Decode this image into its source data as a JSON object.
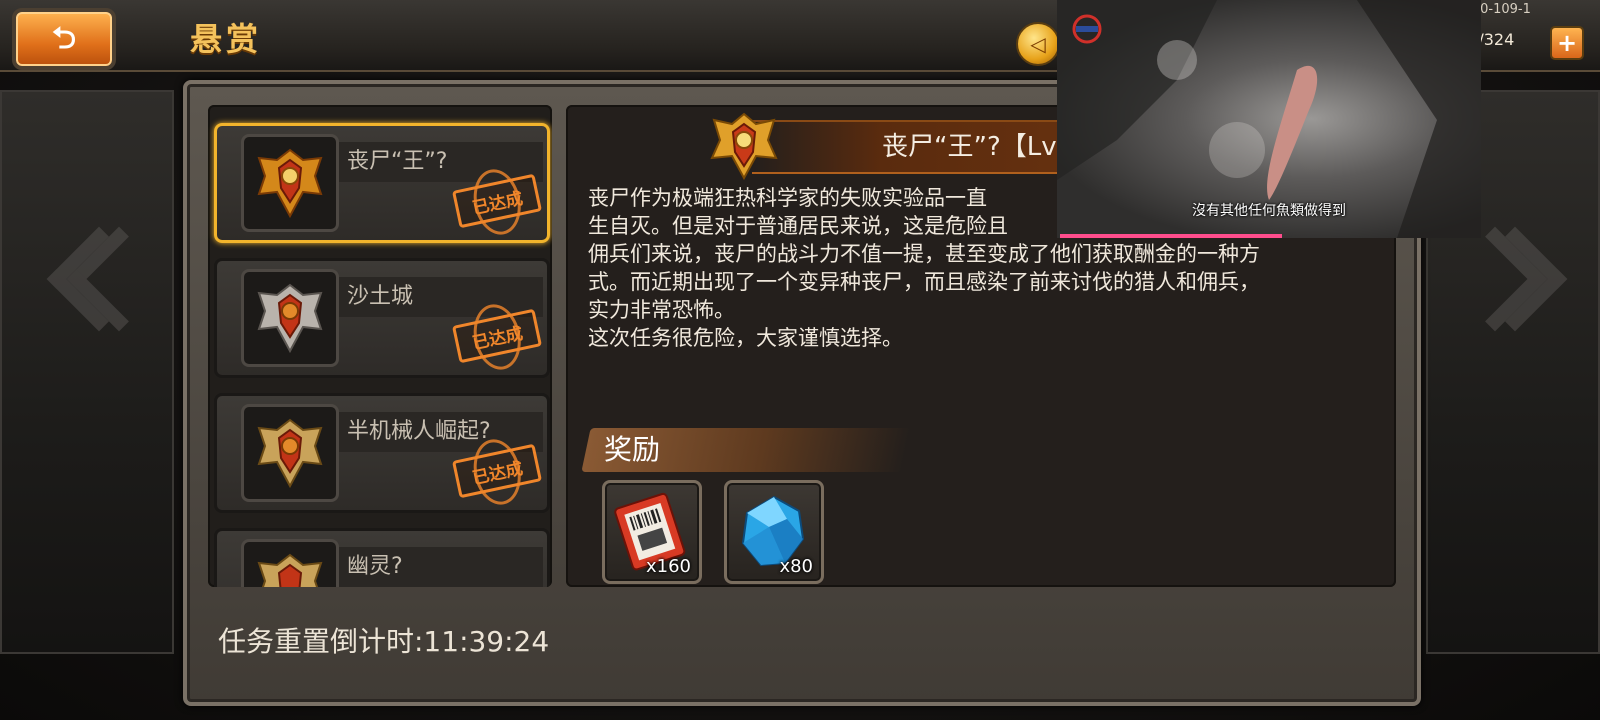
{
  "header": {
    "title": "悬赏",
    "coin_icon": "coin-icon",
    "coin_glyph": "◁",
    "stamina": "94/324",
    "plus": "+",
    "version": ".0-109-1"
  },
  "quests": [
    {
      "name": "丧尸“王”?",
      "status": "已达成",
      "selected": true
    },
    {
      "name": "沙土城",
      "status": "已达成",
      "selected": false
    },
    {
      "name": "半机械人崛起?",
      "status": "已达成",
      "selected": false
    },
    {
      "name": "幽灵?",
      "status": "",
      "selected": false
    }
  ],
  "detail": {
    "title": "丧尸“王”?【Lv.1",
    "description_lines": [
      "丧尸作为极端狂热科学家的失败实验品一直",
      "生自灭。但是对于普通居民来说，这是危险且",
      "佣兵们来说，丧尸的战斗力不值一提，甚至变成了他们获取酬金的一种方",
      "式。而近期出现了一个变异种丧尸，而且感染了前来讨伐的猎人和佣兵，",
      "实力非常恐怖。",
      "这次任务很危险，大家谨慎选择。"
    ],
    "reward_label": "奖励",
    "rewards": [
      {
        "icon": "ticket-icon",
        "qty": "x160"
      },
      {
        "icon": "blue-crystal-icon",
        "qty": "x80"
      }
    ]
  },
  "footer": {
    "reset_timer": "任务重置倒计时:11:39:24"
  },
  "video_overlay": {
    "subtitle": "沒有其他任何魚類做得到"
  },
  "colors": {
    "accent_gold": "#f2b42c",
    "stamp_orange": "#f0862b",
    "title_gold": "#f4c25c",
    "progress_pink": "#ff4d8d"
  }
}
